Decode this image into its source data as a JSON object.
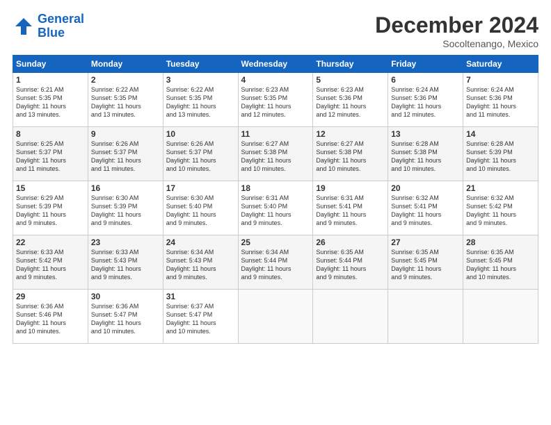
{
  "header": {
    "logo_line1": "General",
    "logo_line2": "Blue",
    "title": "December 2024",
    "location": "Socoltenango, Mexico"
  },
  "days_of_week": [
    "Sunday",
    "Monday",
    "Tuesday",
    "Wednesday",
    "Thursday",
    "Friday",
    "Saturday"
  ],
  "weeks": [
    [
      {
        "day": "1",
        "info": "Sunrise: 6:21 AM\nSunset: 5:35 PM\nDaylight: 11 hours\nand 13 minutes."
      },
      {
        "day": "2",
        "info": "Sunrise: 6:22 AM\nSunset: 5:35 PM\nDaylight: 11 hours\nand 13 minutes."
      },
      {
        "day": "3",
        "info": "Sunrise: 6:22 AM\nSunset: 5:35 PM\nDaylight: 11 hours\nand 13 minutes."
      },
      {
        "day": "4",
        "info": "Sunrise: 6:23 AM\nSunset: 5:35 PM\nDaylight: 11 hours\nand 12 minutes."
      },
      {
        "day": "5",
        "info": "Sunrise: 6:23 AM\nSunset: 5:36 PM\nDaylight: 11 hours\nand 12 minutes."
      },
      {
        "day": "6",
        "info": "Sunrise: 6:24 AM\nSunset: 5:36 PM\nDaylight: 11 hours\nand 12 minutes."
      },
      {
        "day": "7",
        "info": "Sunrise: 6:24 AM\nSunset: 5:36 PM\nDaylight: 11 hours\nand 11 minutes."
      }
    ],
    [
      {
        "day": "8",
        "info": "Sunrise: 6:25 AM\nSunset: 5:37 PM\nDaylight: 11 hours\nand 11 minutes."
      },
      {
        "day": "9",
        "info": "Sunrise: 6:26 AM\nSunset: 5:37 PM\nDaylight: 11 hours\nand 11 minutes."
      },
      {
        "day": "10",
        "info": "Sunrise: 6:26 AM\nSunset: 5:37 PM\nDaylight: 11 hours\nand 10 minutes."
      },
      {
        "day": "11",
        "info": "Sunrise: 6:27 AM\nSunset: 5:38 PM\nDaylight: 11 hours\nand 10 minutes."
      },
      {
        "day": "12",
        "info": "Sunrise: 6:27 AM\nSunset: 5:38 PM\nDaylight: 11 hours\nand 10 minutes."
      },
      {
        "day": "13",
        "info": "Sunrise: 6:28 AM\nSunset: 5:38 PM\nDaylight: 11 hours\nand 10 minutes."
      },
      {
        "day": "14",
        "info": "Sunrise: 6:28 AM\nSunset: 5:39 PM\nDaylight: 11 hours\nand 10 minutes."
      }
    ],
    [
      {
        "day": "15",
        "info": "Sunrise: 6:29 AM\nSunset: 5:39 PM\nDaylight: 11 hours\nand 9 minutes."
      },
      {
        "day": "16",
        "info": "Sunrise: 6:30 AM\nSunset: 5:39 PM\nDaylight: 11 hours\nand 9 minutes."
      },
      {
        "day": "17",
        "info": "Sunrise: 6:30 AM\nSunset: 5:40 PM\nDaylight: 11 hours\nand 9 minutes."
      },
      {
        "day": "18",
        "info": "Sunrise: 6:31 AM\nSunset: 5:40 PM\nDaylight: 11 hours\nand 9 minutes."
      },
      {
        "day": "19",
        "info": "Sunrise: 6:31 AM\nSunset: 5:41 PM\nDaylight: 11 hours\nand 9 minutes."
      },
      {
        "day": "20",
        "info": "Sunrise: 6:32 AM\nSunset: 5:41 PM\nDaylight: 11 hours\nand 9 minutes."
      },
      {
        "day": "21",
        "info": "Sunrise: 6:32 AM\nSunset: 5:42 PM\nDaylight: 11 hours\nand 9 minutes."
      }
    ],
    [
      {
        "day": "22",
        "info": "Sunrise: 6:33 AM\nSunset: 5:42 PM\nDaylight: 11 hours\nand 9 minutes."
      },
      {
        "day": "23",
        "info": "Sunrise: 6:33 AM\nSunset: 5:43 PM\nDaylight: 11 hours\nand 9 minutes."
      },
      {
        "day": "24",
        "info": "Sunrise: 6:34 AM\nSunset: 5:43 PM\nDaylight: 11 hours\nand 9 minutes."
      },
      {
        "day": "25",
        "info": "Sunrise: 6:34 AM\nSunset: 5:44 PM\nDaylight: 11 hours\nand 9 minutes."
      },
      {
        "day": "26",
        "info": "Sunrise: 6:35 AM\nSunset: 5:44 PM\nDaylight: 11 hours\nand 9 minutes."
      },
      {
        "day": "27",
        "info": "Sunrise: 6:35 AM\nSunset: 5:45 PM\nDaylight: 11 hours\nand 9 minutes."
      },
      {
        "day": "28",
        "info": "Sunrise: 6:35 AM\nSunset: 5:45 PM\nDaylight: 11 hours\nand 10 minutes."
      }
    ],
    [
      {
        "day": "29",
        "info": "Sunrise: 6:36 AM\nSunset: 5:46 PM\nDaylight: 11 hours\nand 10 minutes."
      },
      {
        "day": "30",
        "info": "Sunrise: 6:36 AM\nSunset: 5:47 PM\nDaylight: 11 hours\nand 10 minutes."
      },
      {
        "day": "31",
        "info": "Sunrise: 6:37 AM\nSunset: 5:47 PM\nDaylight: 11 hours\nand 10 minutes."
      },
      {
        "day": "",
        "info": ""
      },
      {
        "day": "",
        "info": ""
      },
      {
        "day": "",
        "info": ""
      },
      {
        "day": "",
        "info": ""
      }
    ]
  ]
}
